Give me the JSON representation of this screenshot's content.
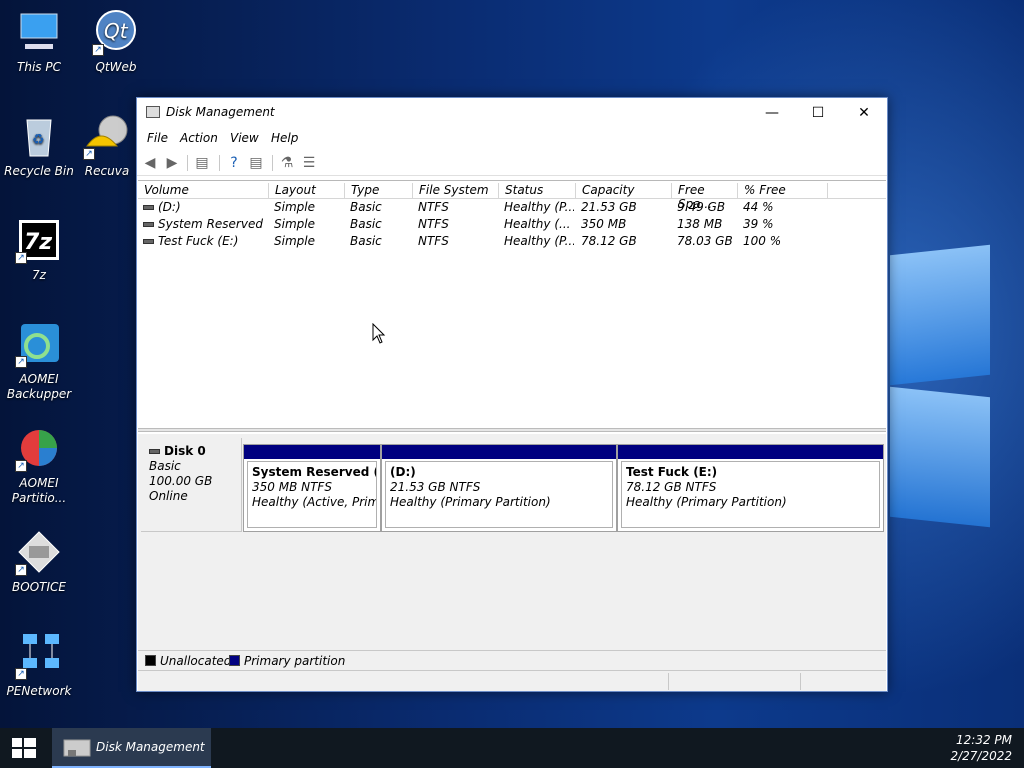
{
  "desktop": {
    "icons": [
      {
        "label": "This PC"
      },
      {
        "label": "QtWeb"
      },
      {
        "label": "Recycle Bin"
      },
      {
        "label": "Recuva"
      },
      {
        "label": "7z"
      },
      {
        "label": "AOMEI Backupper"
      },
      {
        "label": "AOMEI Partitio..."
      },
      {
        "label": "BOOTICE"
      },
      {
        "label": "PENetwork"
      }
    ]
  },
  "window": {
    "title": "Disk Management",
    "menu": [
      "File",
      "Action",
      "View",
      "Help"
    ],
    "columns": [
      "Volume",
      "Layout",
      "Type",
      "File System",
      "Status",
      "Capacity",
      "Free Spa...",
      "% Free"
    ],
    "rows": [
      [
        "(D:)",
        "Simple",
        "Basic",
        "NTFS",
        "Healthy (P...",
        "21.53 GB",
        "9.49 GB",
        "44 %"
      ],
      [
        "System Reserved (...",
        "Simple",
        "Basic",
        "NTFS",
        "Healthy (...",
        "350 MB",
        "138 MB",
        "39 %"
      ],
      [
        "Test Fuck (E:)",
        "Simple",
        "Basic",
        "NTFS",
        "Healthy (P...",
        "78.12 GB",
        "78.03 GB",
        "100 %"
      ]
    ],
    "disk": {
      "name": "Disk 0",
      "type": "Basic",
      "size": "100.00 GB",
      "state": "Online"
    },
    "partitions": [
      {
        "name": "System Reserved  (C:)",
        "size": "350 MB NTFS",
        "status": "Healthy (Active, Primary Partition)"
      },
      {
        "name": "(D:)",
        "size": "21.53 GB NTFS",
        "status": "Healthy (Primary Partition)"
      },
      {
        "name": "Test Fuck  (E:)",
        "size": "78.12 GB NTFS",
        "status": "Healthy (Primary Partition)"
      }
    ],
    "legend": {
      "unallocated": "Unallocated",
      "primary": "Primary partition",
      "unallocated_color": "#000000",
      "primary_color": "#000080"
    }
  },
  "taskbar": {
    "task": "Disk Management",
    "time": "12:32 PM",
    "date": "2/27/2022"
  }
}
